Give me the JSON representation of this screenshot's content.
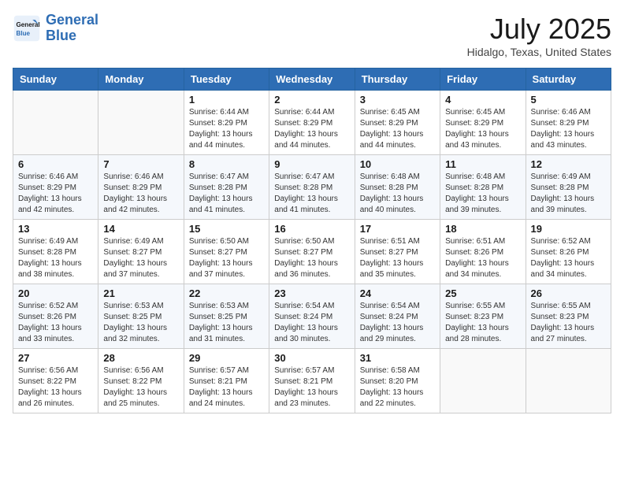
{
  "header": {
    "logo_line1": "General",
    "logo_line2": "Blue",
    "month_year": "July 2025",
    "location": "Hidalgo, Texas, United States"
  },
  "weekdays": [
    "Sunday",
    "Monday",
    "Tuesday",
    "Wednesday",
    "Thursday",
    "Friday",
    "Saturday"
  ],
  "weeks": [
    [
      {
        "day": "",
        "detail": ""
      },
      {
        "day": "",
        "detail": ""
      },
      {
        "day": "1",
        "detail": "Sunrise: 6:44 AM\nSunset: 8:29 PM\nDaylight: 13 hours and 44 minutes."
      },
      {
        "day": "2",
        "detail": "Sunrise: 6:44 AM\nSunset: 8:29 PM\nDaylight: 13 hours and 44 minutes."
      },
      {
        "day": "3",
        "detail": "Sunrise: 6:45 AM\nSunset: 8:29 PM\nDaylight: 13 hours and 44 minutes."
      },
      {
        "day": "4",
        "detail": "Sunrise: 6:45 AM\nSunset: 8:29 PM\nDaylight: 13 hours and 43 minutes."
      },
      {
        "day": "5",
        "detail": "Sunrise: 6:46 AM\nSunset: 8:29 PM\nDaylight: 13 hours and 43 minutes."
      }
    ],
    [
      {
        "day": "6",
        "detail": "Sunrise: 6:46 AM\nSunset: 8:29 PM\nDaylight: 13 hours and 42 minutes."
      },
      {
        "day": "7",
        "detail": "Sunrise: 6:46 AM\nSunset: 8:29 PM\nDaylight: 13 hours and 42 minutes."
      },
      {
        "day": "8",
        "detail": "Sunrise: 6:47 AM\nSunset: 8:28 PM\nDaylight: 13 hours and 41 minutes."
      },
      {
        "day": "9",
        "detail": "Sunrise: 6:47 AM\nSunset: 8:28 PM\nDaylight: 13 hours and 41 minutes."
      },
      {
        "day": "10",
        "detail": "Sunrise: 6:48 AM\nSunset: 8:28 PM\nDaylight: 13 hours and 40 minutes."
      },
      {
        "day": "11",
        "detail": "Sunrise: 6:48 AM\nSunset: 8:28 PM\nDaylight: 13 hours and 39 minutes."
      },
      {
        "day": "12",
        "detail": "Sunrise: 6:49 AM\nSunset: 8:28 PM\nDaylight: 13 hours and 39 minutes."
      }
    ],
    [
      {
        "day": "13",
        "detail": "Sunrise: 6:49 AM\nSunset: 8:28 PM\nDaylight: 13 hours and 38 minutes."
      },
      {
        "day": "14",
        "detail": "Sunrise: 6:49 AM\nSunset: 8:27 PM\nDaylight: 13 hours and 37 minutes."
      },
      {
        "day": "15",
        "detail": "Sunrise: 6:50 AM\nSunset: 8:27 PM\nDaylight: 13 hours and 37 minutes."
      },
      {
        "day": "16",
        "detail": "Sunrise: 6:50 AM\nSunset: 8:27 PM\nDaylight: 13 hours and 36 minutes."
      },
      {
        "day": "17",
        "detail": "Sunrise: 6:51 AM\nSunset: 8:27 PM\nDaylight: 13 hours and 35 minutes."
      },
      {
        "day": "18",
        "detail": "Sunrise: 6:51 AM\nSunset: 8:26 PM\nDaylight: 13 hours and 34 minutes."
      },
      {
        "day": "19",
        "detail": "Sunrise: 6:52 AM\nSunset: 8:26 PM\nDaylight: 13 hours and 34 minutes."
      }
    ],
    [
      {
        "day": "20",
        "detail": "Sunrise: 6:52 AM\nSunset: 8:26 PM\nDaylight: 13 hours and 33 minutes."
      },
      {
        "day": "21",
        "detail": "Sunrise: 6:53 AM\nSunset: 8:25 PM\nDaylight: 13 hours and 32 minutes."
      },
      {
        "day": "22",
        "detail": "Sunrise: 6:53 AM\nSunset: 8:25 PM\nDaylight: 13 hours and 31 minutes."
      },
      {
        "day": "23",
        "detail": "Sunrise: 6:54 AM\nSunset: 8:24 PM\nDaylight: 13 hours and 30 minutes."
      },
      {
        "day": "24",
        "detail": "Sunrise: 6:54 AM\nSunset: 8:24 PM\nDaylight: 13 hours and 29 minutes."
      },
      {
        "day": "25",
        "detail": "Sunrise: 6:55 AM\nSunset: 8:23 PM\nDaylight: 13 hours and 28 minutes."
      },
      {
        "day": "26",
        "detail": "Sunrise: 6:55 AM\nSunset: 8:23 PM\nDaylight: 13 hours and 27 minutes."
      }
    ],
    [
      {
        "day": "27",
        "detail": "Sunrise: 6:56 AM\nSunset: 8:22 PM\nDaylight: 13 hours and 26 minutes."
      },
      {
        "day": "28",
        "detail": "Sunrise: 6:56 AM\nSunset: 8:22 PM\nDaylight: 13 hours and 25 minutes."
      },
      {
        "day": "29",
        "detail": "Sunrise: 6:57 AM\nSunset: 8:21 PM\nDaylight: 13 hours and 24 minutes."
      },
      {
        "day": "30",
        "detail": "Sunrise: 6:57 AM\nSunset: 8:21 PM\nDaylight: 13 hours and 23 minutes."
      },
      {
        "day": "31",
        "detail": "Sunrise: 6:58 AM\nSunset: 8:20 PM\nDaylight: 13 hours and 22 minutes."
      },
      {
        "day": "",
        "detail": ""
      },
      {
        "day": "",
        "detail": ""
      }
    ]
  ]
}
